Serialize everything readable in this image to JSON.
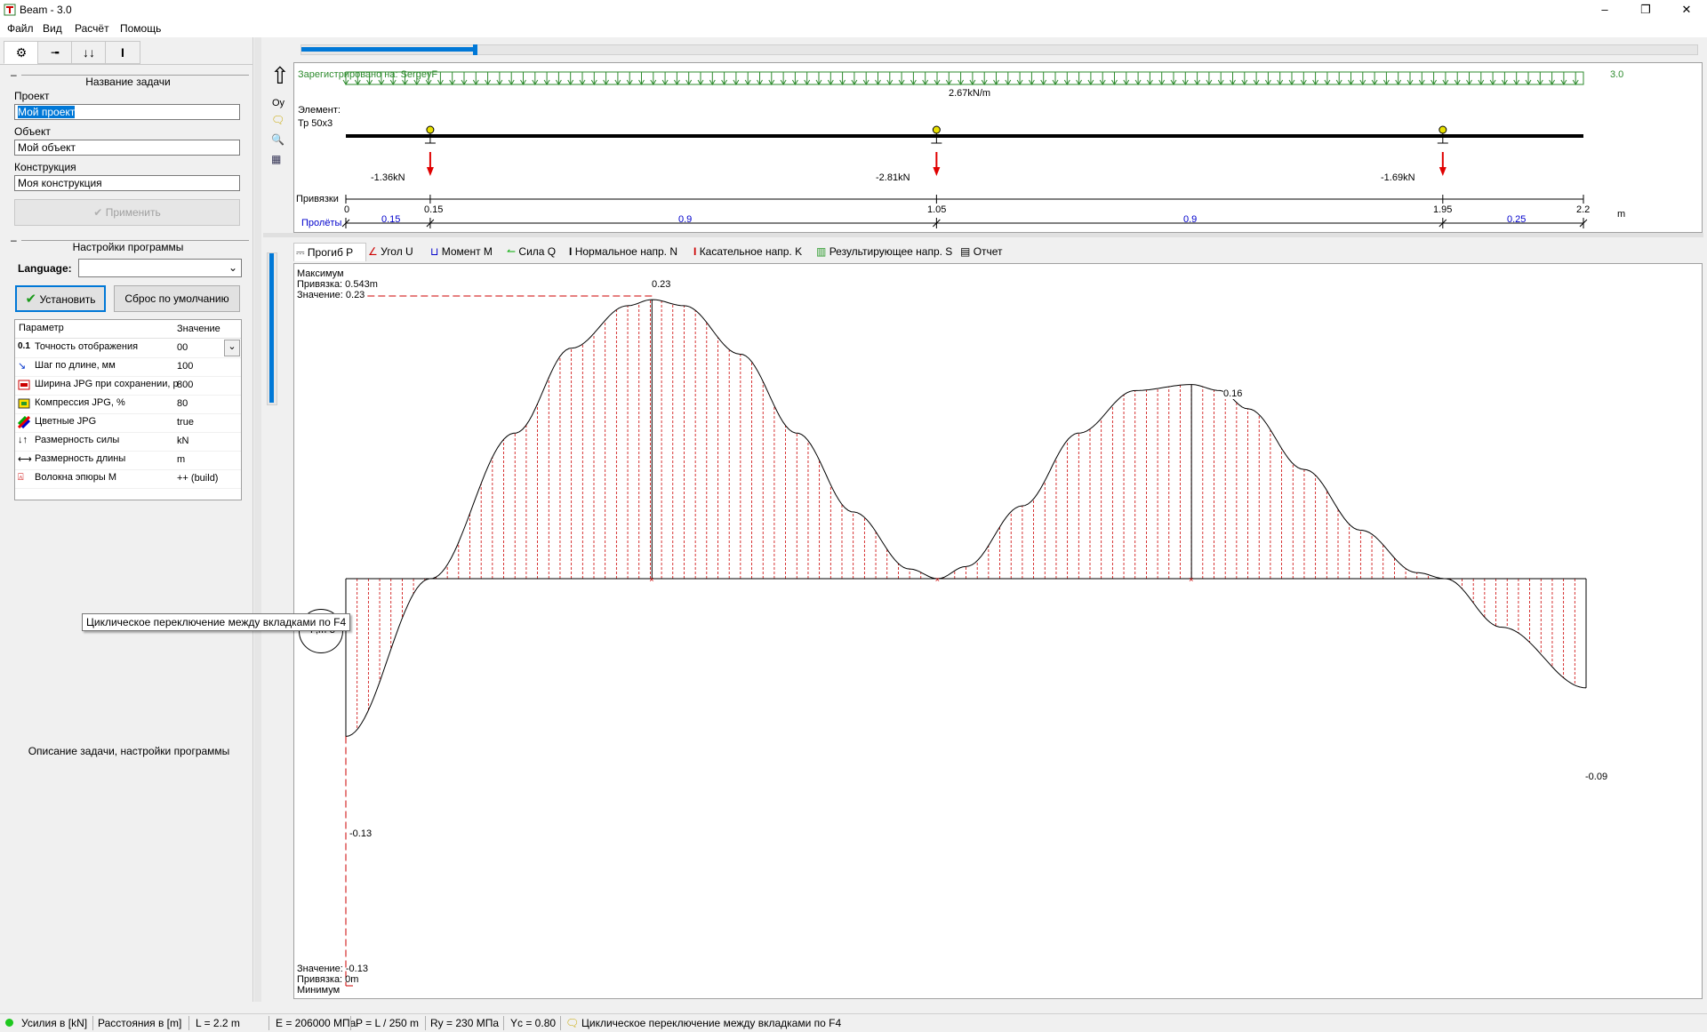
{
  "window": {
    "title": "Beam - 3.0"
  },
  "menu": [
    "Файл",
    "Вид",
    "Расчёт",
    "Помощь"
  ],
  "left": {
    "task_section": "Название задачи",
    "project_label": "Проект",
    "project_value": "Мой проект",
    "object_label": "Объект",
    "object_value": "Мой объект",
    "construction_label": "Конструкция",
    "construction_value": "Моя конструкция",
    "apply_button": "Применить",
    "settings_section": "Настройки программы",
    "language_label": "Language:",
    "language_value": "",
    "install_button": "Установить",
    "reset_button": "Сброс по умолчанию",
    "params_header": {
      "name": "Параметр",
      "value": "Значение"
    },
    "params": [
      {
        "icon": "precision-icon",
        "name": "Точность отображения",
        "value": "00"
      },
      {
        "icon": "step-icon",
        "name": "Шаг по длине, мм",
        "value": "100"
      },
      {
        "icon": "jpg-width-icon",
        "name": "Ширина JPG при сохранении, р",
        "value": "800"
      },
      {
        "icon": "jpg-compress-icon",
        "name": "Компрессия JPG, %",
        "value": "80"
      },
      {
        "icon": "color-icon",
        "name": "Цветные JPG",
        "value": "true"
      },
      {
        "icon": "force-unit-icon",
        "name": "Размерность силы",
        "value": "kN"
      },
      {
        "icon": "length-unit-icon",
        "name": "Размерность длины",
        "value": "m"
      },
      {
        "icon": "fiber-icon",
        "name": "Волокна эпюры М",
        "value": "++ (build)"
      }
    ],
    "description": "Описание задачи, настройки программы"
  },
  "scheme": {
    "registered": "Зарегистрировано на: SergeyF",
    "version_right": "3.0",
    "oy_label": "Oy",
    "element_label": "Элемент:",
    "element_value": "Тр 50х3",
    "dist_load": "2.67kN/m",
    "reactions": [
      {
        "label": "-1.36kN"
      },
      {
        "label": "-2.81kN"
      },
      {
        "label": "-1.69kN"
      }
    ],
    "anchors_label": "Привязки",
    "anchors": [
      "0",
      "0.15",
      "1.05",
      "1.95",
      "2.2"
    ],
    "unit": "m",
    "spans_label": "Пролёты",
    "spans": [
      "0.15",
      "0.9",
      "0.9",
      "0.25"
    ]
  },
  "tabs": [
    {
      "icon": "deflection-icon",
      "label": "Прогиб P"
    },
    {
      "icon": "angle-icon",
      "label": "Угол U"
    },
    {
      "icon": "moment-icon",
      "label": "Момент M"
    },
    {
      "icon": "shear-icon",
      "label": "Сила Q"
    },
    {
      "icon": "normal-stress-icon",
      "label": "Нормальное напр. N"
    },
    {
      "icon": "shear-stress-icon",
      "label": "Касательное напр. K"
    },
    {
      "icon": "resulting-stress-icon",
      "label": "Результирующее напр. S"
    },
    {
      "icon": "report-icon",
      "label": "Отчет"
    }
  ],
  "plot": {
    "max_block": {
      "title": "Максимум",
      "anchor": "Привязка: 0.543m",
      "value": "Значение: 0.23"
    },
    "min_block": {
      "value": "Значение: -0.13",
      "anchor": "Привязка: 0m",
      "title": "Минимум"
    },
    "units_label": "P,m-3",
    "labels": {
      "max1": "0.23",
      "max2": "0.16",
      "min_left": "-0.13",
      "end_right": "-0.09"
    }
  },
  "chart_data": {
    "type": "area",
    "title": "Прогиб P",
    "xlabel": "m",
    "ylabel": "P,m-3",
    "xlim": [
      0,
      2.2
    ],
    "series": [
      {
        "name": "Прогиб P",
        "x": [
          0,
          0.15,
          0.3,
          0.4,
          0.5,
          0.543,
          0.6,
          0.7,
          0.8,
          0.9,
          1.0,
          1.05,
          1.1,
          1.2,
          1.3,
          1.4,
          1.5,
          1.55,
          1.6,
          1.7,
          1.8,
          1.9,
          1.95,
          2.05,
          2.2
        ],
        "y": [
          -0.13,
          0.0,
          0.12,
          0.19,
          0.225,
          0.23,
          0.225,
          0.185,
          0.12,
          0.055,
          0.008,
          0.0,
          0.01,
          0.06,
          0.12,
          0.155,
          0.16,
          0.155,
          0.14,
          0.09,
          0.04,
          0.005,
          -0.0,
          -0.04,
          -0.09
        ]
      }
    ],
    "annotations": [
      "0.23",
      "0.16",
      "-0.13",
      "-0.09"
    ]
  },
  "tooltip": "Циклическое переключение между вкладками по F4",
  "status": {
    "forces": "Усилия в [kN]",
    "distances": "Расстояния в [m]",
    "length": "L = 2.2 m",
    "modulus": "E = 206000 МПа",
    "deflection_limit": "P = L / 250 m",
    "ry": "Ry = 230 МПа",
    "yc": "Yc = 0.80",
    "hint": "Циклическое переключение между вкладками по F4"
  },
  "colors": {
    "load": "#2e8b2e",
    "force": "#e00000",
    "span": "#0000cc",
    "hatch": "#cc0000",
    "accent": "#0078d7"
  }
}
